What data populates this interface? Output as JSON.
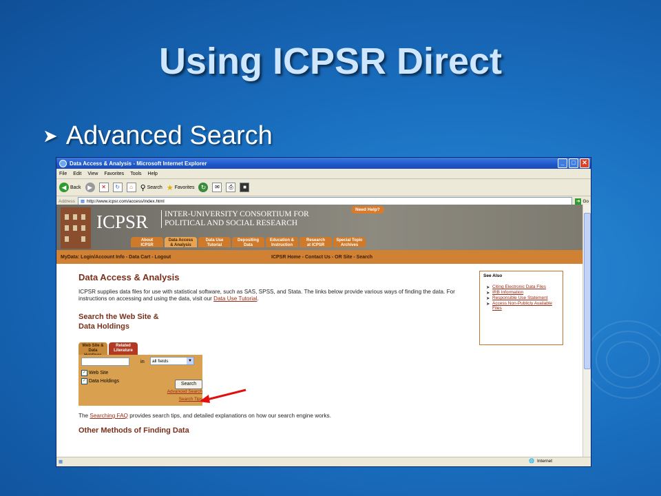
{
  "slide": {
    "title": "Using ICPSR Direct",
    "bullet": "Advanced Search"
  },
  "browser": {
    "window_title": "Data Access & Analysis - Microsoft Internet Explorer",
    "menu": [
      "File",
      "Edit",
      "View",
      "Favorites",
      "Tools",
      "Help"
    ],
    "toolbar": {
      "back": "Back",
      "search": "Search",
      "favorites": "Favorites"
    },
    "address_label": "Address",
    "url": "http://www.icpsr.com/access/index.html",
    "go": "Go",
    "status_zone": "Internet"
  },
  "site": {
    "logo": "ICPSR",
    "logo_sub_1": "INTER-UNIVERSITY CONSORTIUM FOR",
    "logo_sub_2": "POLITICAL AND SOCIAL RESEARCH",
    "need_help": "Need Help?",
    "nav_tabs": [
      {
        "l1": "About",
        "l2": "ICPSR"
      },
      {
        "l1": "Data Access",
        "l2": "& Analysis"
      },
      {
        "l1": "Data Use",
        "l2": "Tutorial"
      },
      {
        "l1": "Depositing",
        "l2": "Data"
      },
      {
        "l1": "Education &",
        "l2": "Instruction"
      },
      {
        "l1": "Research",
        "l2": "at ICPSR"
      },
      {
        "l1": "Special Topic",
        "l2": "Archives"
      }
    ],
    "bar_left": "MyData: Login/Account Info - Data Cart - Logout",
    "bar_center": "ICPSR Home - Contact Us - OR Site - Search"
  },
  "page": {
    "heading": "Data Access & Analysis",
    "intro_1": "ICPSR supplies data files for use with statistical software, such as SAS, SPSS, and Stata. The links below provide various ways of finding the data. For instructions on accessing and using the data, visit our ",
    "intro_link": "Data Use Tutorial",
    "intro_end": ".",
    "search_heading_1": "Search the Web Site &",
    "search_heading_2": "Data Holdings",
    "see_also": {
      "title": "See Also",
      "items": [
        "Citing Electronic Data Files",
        "IRB Information",
        "Responsible Use Statement",
        "Access Non-Publicly Available Files"
      ]
    },
    "search_box": {
      "tab1_l1": "Web Site &",
      "tab1_l2": "Data Holdings",
      "tab2_l1": "Related",
      "tab2_l2": "Literature",
      "in": "in",
      "select": "all fields",
      "check1": "Web Site",
      "check2": "Data Holdings",
      "button": "Search",
      "advanced": "Advanced Search",
      "tips": "Search Tips"
    },
    "faq_pre": "The ",
    "faq_link": "Searching FAQ",
    "faq_post": " provides search tips, and detailed explanations on how our search engine works.",
    "other_heading": "Other Methods of Finding Data"
  },
  "colors": {
    "slide_bg": "#1a6fc0",
    "brand": "#d08133",
    "heading": "#7a2f1a",
    "arrow": "#e01010"
  }
}
